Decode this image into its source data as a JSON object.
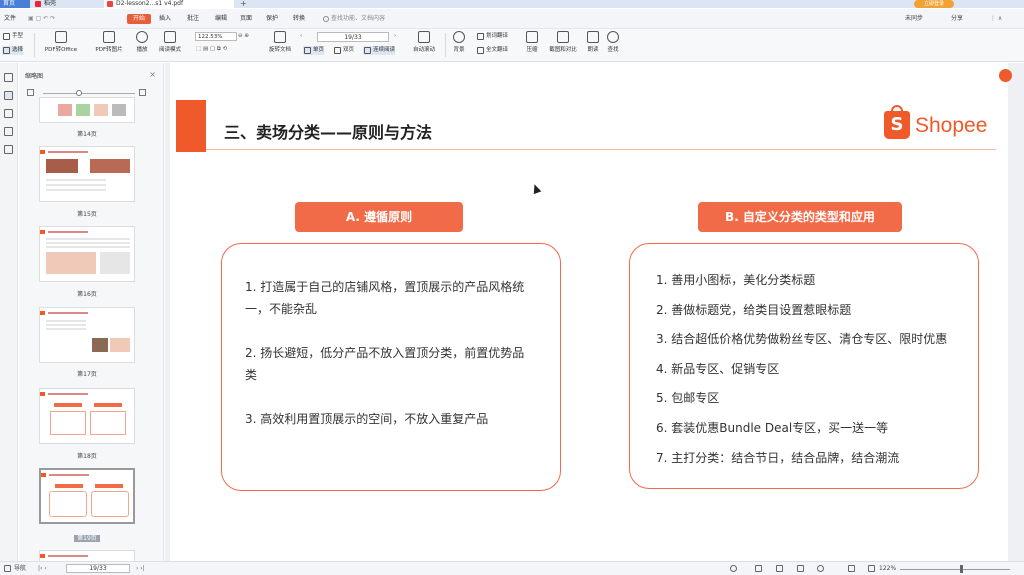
{
  "tabs": {
    "home": "首页",
    "wps": "稻壳",
    "pdf": "D2-lesson2...s1 v4.pdf",
    "new": "+"
  },
  "user_badge": "立即登录",
  "menu": {
    "file": "文件",
    "start": "开始",
    "insert": "插入",
    "annotate": "批注",
    "edit": "编辑",
    "page": "页面",
    "protect": "保护",
    "convert": "转换",
    "search_placeholder": "查找功能、文档内容",
    "unsync": "未同步",
    "share": "分享"
  },
  "toolbar": {
    "hand": "手型",
    "select": "选择",
    "pdf_to_office": "PDF转Office",
    "pdf_to_image": "PDF转图片",
    "play": "播放",
    "read_mode": "阅读模式",
    "zoom_value": "122.53%",
    "rotate": "旋转文档",
    "single": "单页",
    "double": "双页",
    "continuous": "连续阅读",
    "auto_scroll": "自动滚动",
    "page_value": "19/33",
    "background": "背景",
    "translate": "划词翻译",
    "full_translate": "全文翻译",
    "compress": "压缩",
    "screenshot": "截图和对比",
    "read": "朗读",
    "find": "查找"
  },
  "thumbnails": {
    "title": "缩略图",
    "pages": [
      {
        "label": "第14页"
      },
      {
        "label": "第15页"
      },
      {
        "label": "第16页"
      },
      {
        "label": "第17页"
      },
      {
        "label": "第18页"
      },
      {
        "label": "第19页"
      }
    ]
  },
  "slide": {
    "title": "三、卖场分类——原则与方法",
    "logo_text": "Shopee",
    "logo_letter": "S",
    "section_a": "A. 遵循原则",
    "section_b": "B. 自定义分类的类型和应用",
    "list_a": [
      "1.    打造属于自己的店铺风格，置顶展示的产品风格统一，不能杂乱",
      "2.    扬长避短，低分产品不放入置顶分类，前置优势品类",
      "3.    高效利用置顶展示的空间，不放入重复产品"
    ],
    "list_b": [
      "1.    善用小图标，美化分类标题",
      "2.    善做标题党，给类目设置惹眼标题",
      "3.    结合超低价格优势做粉丝专区、清仓专区、限时优惠",
      "4.    新品专区、促销专区",
      "5.    包邮专区",
      "6.    套装优惠Bundle Deal专区，买一送一等",
      "7.    主打分类：结合节日，结合品牌，结合潮流"
    ]
  },
  "status": {
    "page_value": "19/33",
    "zoom": "122%",
    "outline": "导航"
  },
  "colors": {
    "accent": "#f26b49",
    "shopee": "#f0592a"
  }
}
